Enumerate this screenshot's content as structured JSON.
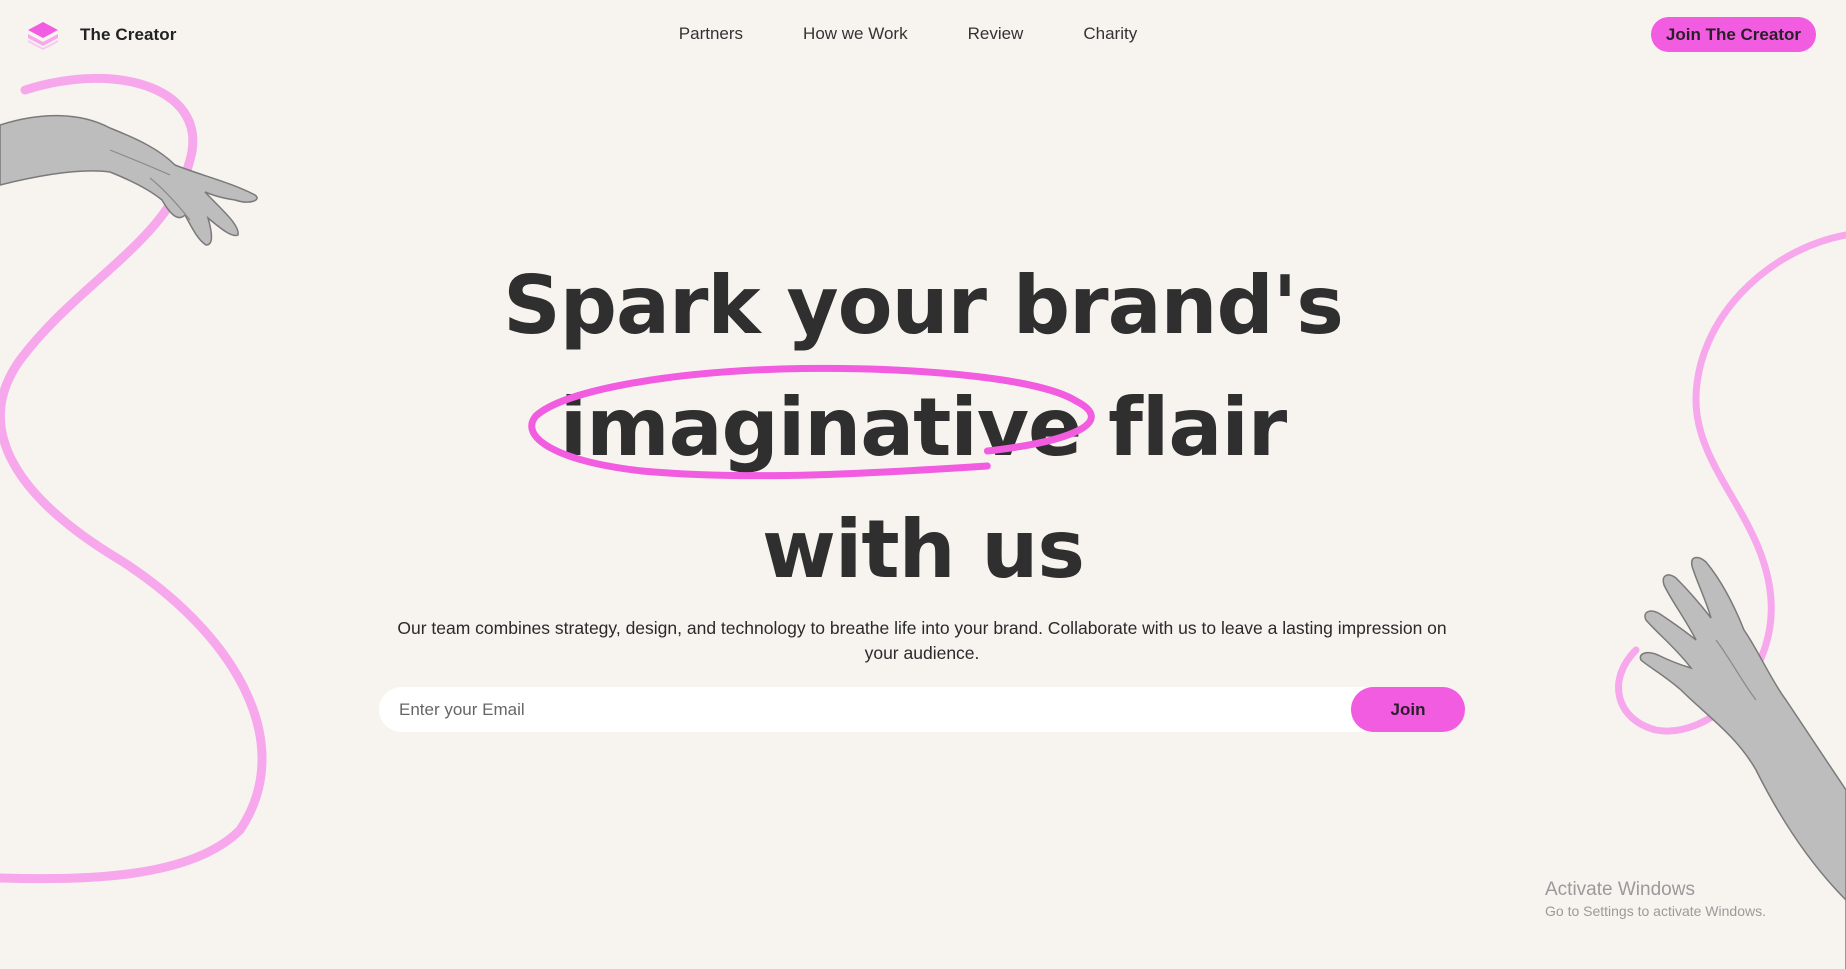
{
  "brand": {
    "name": "The Creator",
    "logo_icon": "stacked-layers-icon",
    "accent_color": "#f25ce0"
  },
  "nav": {
    "items": [
      {
        "label": "Partners"
      },
      {
        "label": "How we Work"
      },
      {
        "label": "Review"
      },
      {
        "label": "Charity"
      }
    ],
    "cta_label": "Join The Creator"
  },
  "hero": {
    "line1": "Spark your brand's",
    "highlight": "imaginative",
    "line2_rest": "flair",
    "line3": "with us",
    "subtext": "Our team combines strategy, design, and technology to breathe life into your brand. Collaborate with us to leave a lasting impression on your audience."
  },
  "signup": {
    "placeholder": "Enter your Email",
    "value": "",
    "button_label": "Join"
  },
  "watermark": {
    "title": "Activate Windows",
    "subtitle": "Go to Settings to activate Windows."
  }
}
